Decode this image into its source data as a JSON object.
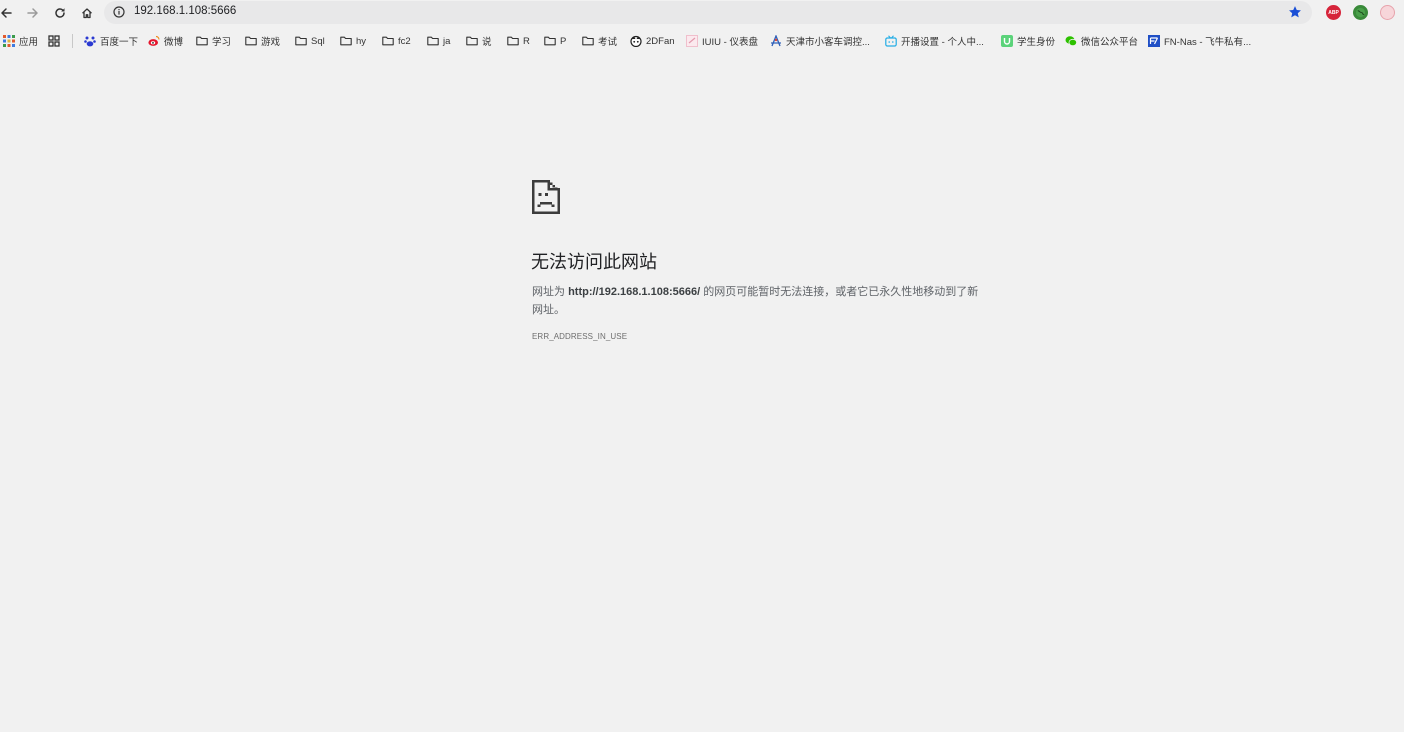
{
  "toolbar": {
    "url": "192.168.1.108:5666"
  },
  "bookmarks": [
    {
      "label": "应用",
      "icon": "apps-grid-icon"
    },
    {
      "label": "",
      "icon": "tab-groups-icon"
    },
    {
      "label": "百度一下",
      "icon": "baidu-icon"
    },
    {
      "label": "微博",
      "icon": "weibo-icon"
    },
    {
      "label": "学习",
      "icon": "folder-icon"
    },
    {
      "label": "游戏",
      "icon": "folder-icon"
    },
    {
      "label": "Sql",
      "icon": "folder-icon"
    },
    {
      "label": "hy",
      "icon": "folder-icon"
    },
    {
      "label": "fc2",
      "icon": "folder-icon"
    },
    {
      "label": "ja",
      "icon": "folder-icon"
    },
    {
      "label": "说",
      "icon": "folder-icon"
    },
    {
      "label": "R",
      "icon": "folder-icon"
    },
    {
      "label": "P",
      "icon": "folder-icon"
    },
    {
      "label": "考试",
      "icon": "folder-icon"
    },
    {
      "label": "2DFan",
      "icon": "2dfan-icon"
    },
    {
      "label": "IUIU - 仪表盘",
      "icon": "iuiu-icon"
    },
    {
      "label": "天津市小客车调控...",
      "icon": "car-control-icon"
    },
    {
      "label": "开播设置 - 个人中...",
      "icon": "bilibili-tv-icon"
    },
    {
      "label": "学生身份",
      "icon": "student-u-icon"
    },
    {
      "label": "微信公众平台",
      "icon": "wechat-icon"
    },
    {
      "label": "FN-Nas - 飞牛私有...",
      "icon": "fn-nas-icon"
    }
  ],
  "extensions": [
    "adblock-plus-icon",
    "globe-extension-icon",
    "pink-extension-icon"
  ],
  "colors": {
    "page_bg": "#f1f1f1",
    "star": "#1a4fd6",
    "abp": "#d6243a",
    "globe": "#3a8a3a"
  },
  "error": {
    "title": "无法访问此网站",
    "desc_prefix": "网址为 ",
    "desc_url": "http://192.168.1.108:5666/",
    "desc_suffix": " 的网页可能暂时无法连接，或者它已永久性地移动到了新网址。",
    "code": "ERR_ADDRESS_IN_USE"
  }
}
